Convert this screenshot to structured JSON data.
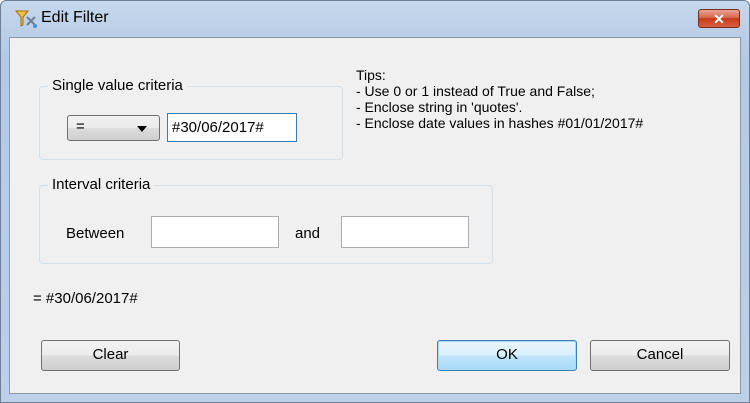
{
  "window": {
    "title": "Edit Filter",
    "close_label": "✕",
    "accent": "#c7391d"
  },
  "single": {
    "legend": "Single value criteria",
    "operator": "=",
    "value": "#30/06/2017#"
  },
  "tips": {
    "heading": "Tips:",
    "line1": "- Use 0 or 1 instead of True and False;",
    "line2": "- Enclose string in 'quotes'.",
    "line3": "- Enclose date values in hashes #01/01/2017#"
  },
  "interval": {
    "legend": "Interval criteria",
    "between_label": "Between",
    "and_label": "and",
    "from_value": "",
    "to_value": ""
  },
  "expression": "= #30/06/2017#",
  "buttons": {
    "clear": "Clear",
    "ok": "OK",
    "cancel": "Cancel"
  }
}
